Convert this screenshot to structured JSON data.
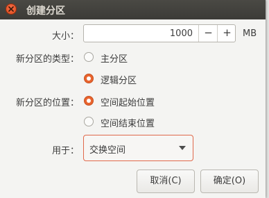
{
  "window": {
    "title": "创建分区"
  },
  "size": {
    "label": "大小：",
    "value": "1000",
    "decrement": "−",
    "increment": "+",
    "unit": "MB"
  },
  "partition_type": {
    "label": "新分区的类型：",
    "options": [
      {
        "label": "主分区",
        "checked": false
      },
      {
        "label": "逻辑分区",
        "checked": true
      }
    ]
  },
  "partition_location": {
    "label": "新分区的位置：",
    "options": [
      {
        "label": "空间起始位置",
        "checked": true
      },
      {
        "label": "空间结束位置",
        "checked": false
      }
    ]
  },
  "use_as": {
    "label": "用于：",
    "selected": "交换空间"
  },
  "buttons": {
    "cancel": "取消(C)",
    "ok": "确定(O)"
  },
  "colors": {
    "accent": "#e9642e",
    "titlebar": "#3c3b37",
    "close": "#df4a16"
  }
}
